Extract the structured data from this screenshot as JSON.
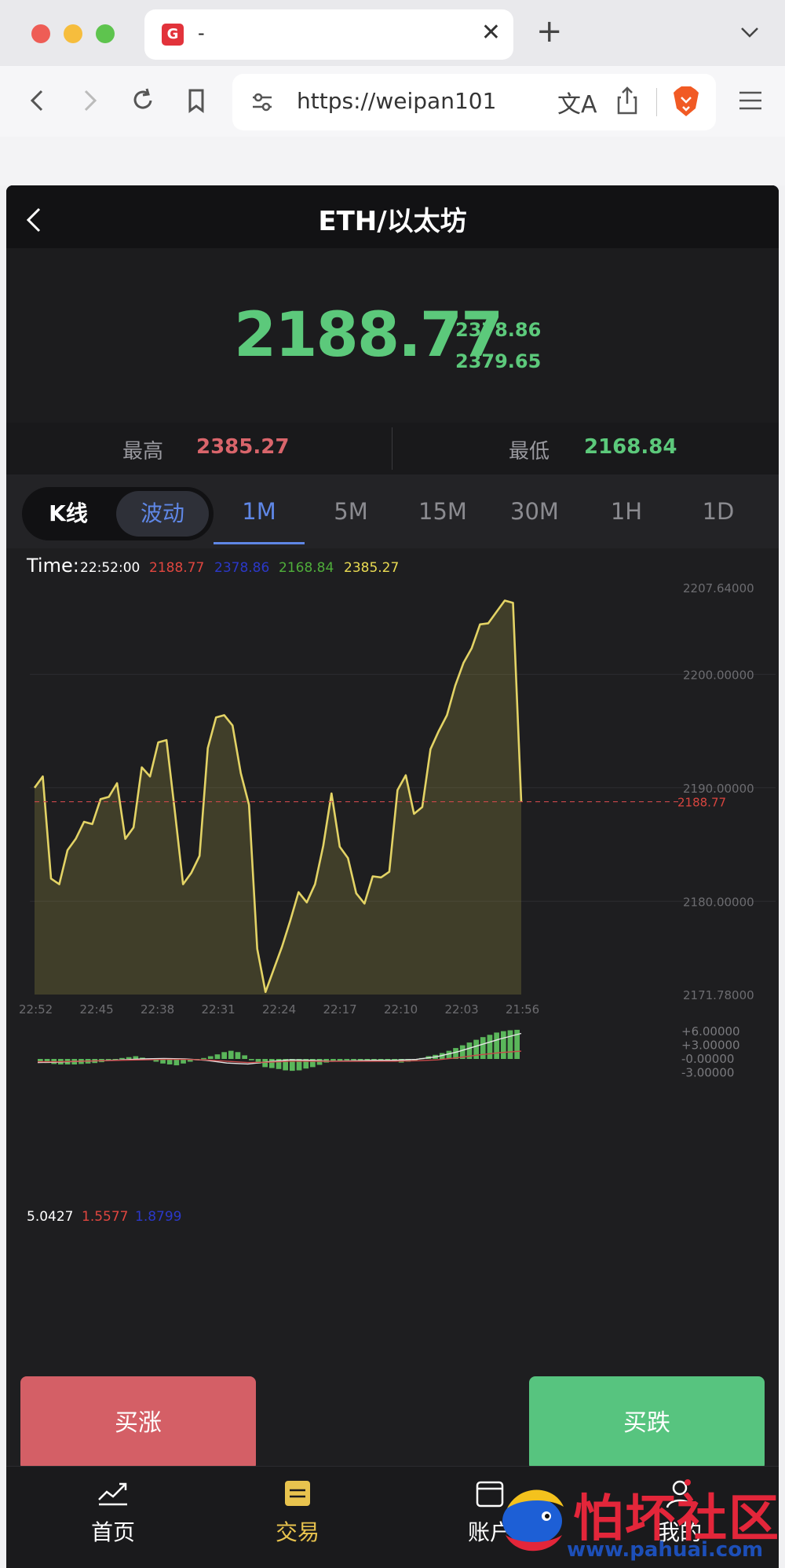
{
  "browser": {
    "tab_favicon_letter": "G",
    "tab_title": "-",
    "url": "https://weipan101",
    "traffic_colors": [
      "#ee5d56",
      "#f6bd3d",
      "#5ec44e"
    ]
  },
  "app": {
    "title": "ETH/以太坊",
    "price": "2188.77",
    "price_sub_1": "2378.86",
    "price_sub_2": "2379.65",
    "high_label": "最高",
    "high_value": "2385.27",
    "low_label": "最低",
    "low_value": "2168.84",
    "tab_kline": "K线",
    "tab_wave": "波动",
    "periods": [
      "1M",
      "5M",
      "15M",
      "30M",
      "1H",
      "1D"
    ],
    "active_period": "1M",
    "buy_up": "买涨",
    "buy_down": "买跌",
    "nav": [
      "首页",
      "交易",
      "账户",
      "我的"
    ],
    "active_nav": "交易",
    "colors": {
      "up": "#5cc97b",
      "down": "#d9656b",
      "accent": "#5f87e6",
      "line": "#e3d365",
      "nav_active": "#e8c34e"
    }
  },
  "chart_data": [
    {
      "type": "area",
      "legend": {
        "time_label": "Time:",
        "time": "22:52:00",
        "values": [
          "2188.77",
          "2378.86",
          "2168.84",
          "2385.27"
        ],
        "colors": [
          "#e0463f",
          "#2b38c9",
          "#4fae3a",
          "#eadb52"
        ]
      },
      "x": [
        "22:52",
        "22:45",
        "22:38",
        "22:31",
        "22:24",
        "22:17",
        "22:10",
        "22:03",
        "21:56"
      ],
      "y_ticks": [
        "2207.64000",
        "2200.00000",
        "2190.00000",
        "2180.00000",
        "2171.78000"
      ],
      "ylim": [
        2171.78,
        2207.64
      ],
      "last_price_label": "2188.77",
      "values": [
        2190.0,
        2191.0,
        2182.0,
        2181.5,
        2184.5,
        2185.5,
        2187.0,
        2186.8,
        2189.0,
        2189.2,
        2190.4,
        2185.5,
        2186.5,
        2191.8,
        2191.0,
        2194.0,
        2194.2,
        2188.0,
        2181.5,
        2182.5,
        2184.0,
        2193.5,
        2196.2,
        2196.4,
        2195.5,
        2191.3,
        2188.5,
        2175.8,
        2172.0,
        2174.0,
        2176.0,
        2178.3,
        2180.8,
        2179.9,
        2181.5,
        2184.9,
        2189.5,
        2184.8,
        2183.8,
        2180.7,
        2179.8,
        2182.2,
        2182.1,
        2182.6,
        2189.8,
        2191.1,
        2187.7,
        2188.3,
        2193.4,
        2195.0,
        2196.4,
        2199.0,
        2201.0,
        2202.3,
        2204.4,
        2204.5,
        2205.5,
        2206.5,
        2206.3,
        2188.77
      ]
    },
    {
      "type": "bar",
      "legend": {
        "values": [
          "5.0427",
          "1.5577",
          "1.8799"
        ],
        "colors": [
          "#ffffff",
          "#e0463f",
          "#2b38c9"
        ]
      },
      "y_ticks": [
        "+6.00000",
        "+3.00000",
        "-0.00000",
        "-3.00000"
      ],
      "ylim": [
        -3,
        6
      ],
      "values": [
        -0.6,
        -0.9,
        -1.1,
        -1.2,
        -1.2,
        -1.2,
        -1.1,
        -1.0,
        -0.9,
        -0.7,
        -0.4,
        -0.2,
        0.2,
        0.4,
        0.6,
        0.3,
        -0.2,
        -0.6,
        -1.0,
        -1.2,
        -1.4,
        -1.0,
        -0.6,
        -0.3,
        0.2,
        0.6,
        1.0,
        1.5,
        1.8,
        1.5,
        0.8,
        -0.3,
        -1.0,
        -1.8,
        -2.0,
        -2.2,
        -2.5,
        -2.6,
        -2.5,
        -2.1,
        -1.8,
        -1.3,
        -0.8,
        -0.5,
        -0.4,
        -0.3,
        -0.2,
        -0.1,
        -0.3,
        -0.5,
        -0.6,
        -0.5,
        -0.6,
        -0.8,
        -0.6,
        -0.3,
        0.2,
        0.6,
        0.9,
        1.3,
        1.8,
        2.4,
        3.0,
        3.6,
        4.2,
        4.8,
        5.3,
        5.8,
        6.1,
        6.3,
        6.4
      ],
      "line_white": [
        -0.8,
        -0.7,
        -0.5,
        -0.4,
        -0.2,
        0.0,
        0.1,
        0.0,
        -0.3,
        -0.9,
        -1.1,
        -0.6,
        -0.2,
        -0.3,
        -0.5,
        -0.4,
        -0.3,
        -0.3,
        -0.1,
        0.5,
        1.6,
        3.0,
        4.4,
        5.6
      ],
      "line_red": [
        -0.6,
        -0.6,
        -0.5,
        -0.4,
        -0.3,
        -0.2,
        -0.1,
        -0.1,
        -0.2,
        -0.5,
        -0.8,
        -0.7,
        -0.5,
        -0.5,
        -0.5,
        -0.5,
        -0.5,
        -0.5,
        -0.4,
        -0.2,
        0.3,
        0.9,
        1.4,
        1.7
      ]
    }
  ],
  "watermark": {
    "text": "怕坏社区",
    "url": "www.pahuai.com"
  }
}
